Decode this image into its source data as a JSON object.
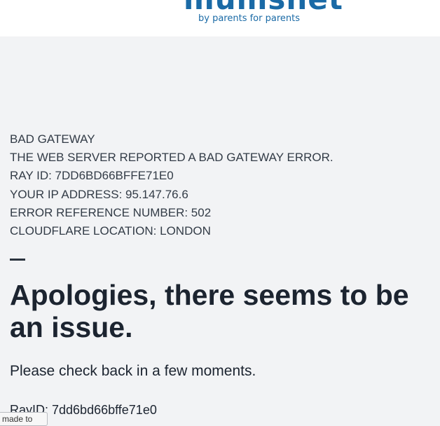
{
  "header": {
    "logo_text": "mumsnet",
    "tagline": "by parents for parents"
  },
  "error": {
    "lines": [
      "BAD GATEWAY",
      "THE WEB SERVER REPORTED A BAD GATEWAY ERROR.",
      "RAY ID: 7DD6BD66BFFE71E0",
      "YOUR IP ADDRESS: 95.147.76.6",
      "ERROR REFERENCE NUMBER: 502",
      "CLOUDFLARE LOCATION: LONDON"
    ]
  },
  "main": {
    "headline": "Apologies, there seems to be an issue.",
    "subtext": "Please check back in a few moments.",
    "rayid": "RayID: 7dd6bd66bffe71e0"
  },
  "tooltip": {
    "text": "made to"
  },
  "colors": {
    "brand": "#1a6aa6",
    "background": "#f2f3f5",
    "text": "#1c2430"
  }
}
